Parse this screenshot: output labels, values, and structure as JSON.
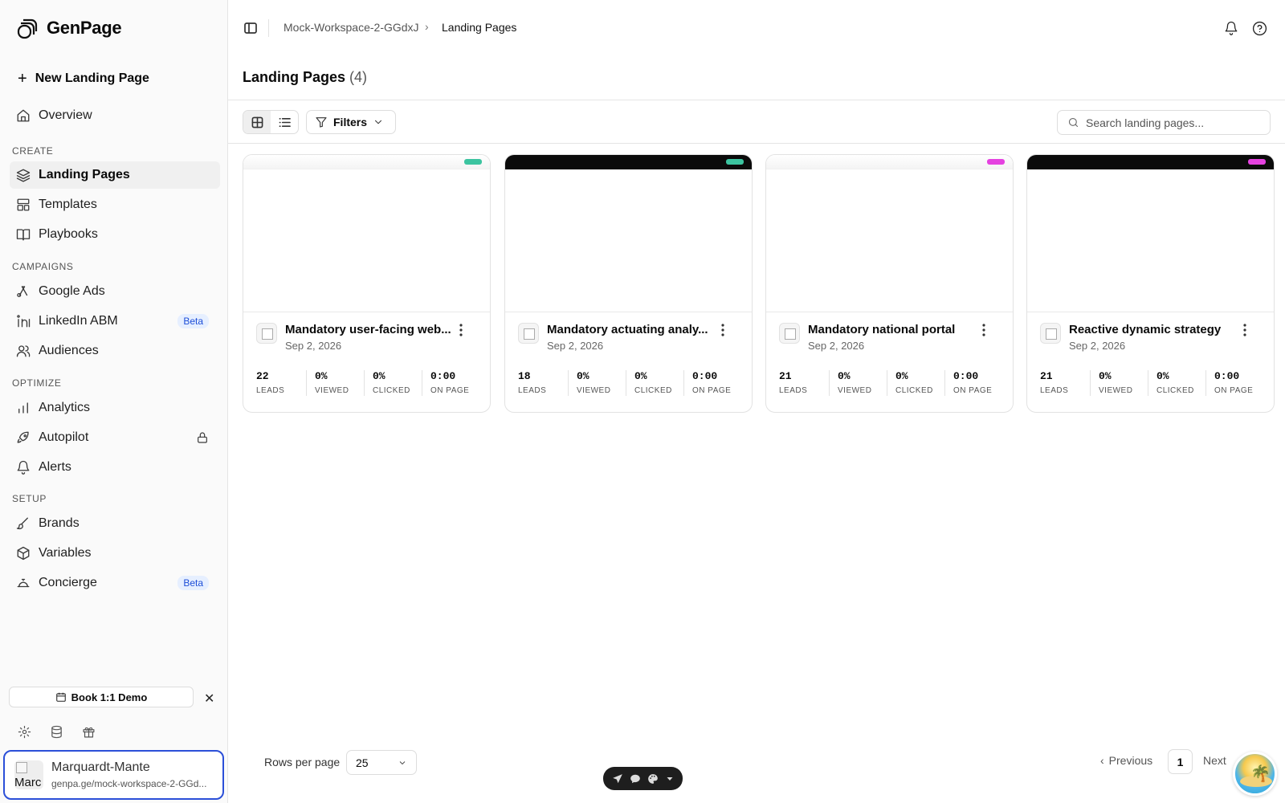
{
  "app": {
    "name": "GenPage"
  },
  "sidebar": {
    "new_page_label": "New Landing Page",
    "overview": {
      "label": "Overview",
      "icon": "home-icon"
    },
    "sections": {
      "create": "CREATE",
      "campaigns": "CAMPAIGNS",
      "optimize": "OPTIMIZE",
      "setup": "SETUP"
    },
    "items": {
      "landing_pages": {
        "label": "Landing Pages",
        "icon": "layers-icon"
      },
      "templates": {
        "label": "Templates",
        "icon": "layout-icon"
      },
      "playbooks": {
        "label": "Playbooks",
        "icon": "book-icon"
      },
      "google_ads": {
        "label": "Google Ads",
        "icon": "google-ads-icon"
      },
      "linkedin_abm": {
        "label": "LinkedIn ABM",
        "badge": "Beta",
        "icon": "linkedin-icon"
      },
      "audiences": {
        "label": "Audiences",
        "icon": "users-icon"
      },
      "analytics": {
        "label": "Analytics",
        "icon": "bar-chart-icon"
      },
      "autopilot": {
        "label": "Autopilot",
        "icon": "rocket-icon"
      },
      "alerts": {
        "label": "Alerts",
        "icon": "bell-icon"
      },
      "brands": {
        "label": "Brands",
        "icon": "brush-icon"
      },
      "variables": {
        "label": "Variables",
        "icon": "box-icon"
      },
      "concierge": {
        "label": "Concierge",
        "badge": "Beta",
        "icon": "concierge-bell-icon"
      }
    },
    "demo_button": "Book 1:1 Demo",
    "workspace": {
      "name": "Marquardt-Mante",
      "url": "genpa.ge/mock-workspace-2-GGd...",
      "avatar_text": "Marc"
    }
  },
  "header": {
    "breadcrumb": [
      "Mock-Workspace-2-GGdxJ",
      "Landing Pages"
    ],
    "title": "Landing Pages",
    "count": "(4)"
  },
  "toolbar": {
    "filters_label": "Filters",
    "search_placeholder": "Search landing pages..."
  },
  "colors": {
    "accent_teal": "#3cc4a0",
    "accent_magenta": "#e542e0",
    "focus_ring": "#2b4fd8"
  },
  "cards": [
    {
      "name": "Mandatory user-facing web...",
      "date": "Sep 2, 2026",
      "theme": "light",
      "chip_color": "#3cc4a0",
      "stats": [
        {
          "value": "22",
          "label": "LEADS"
        },
        {
          "value": "0%",
          "label": "VIEWED"
        },
        {
          "value": "0%",
          "label": "CLICKED"
        },
        {
          "value": "0:00",
          "label": "ON PAGE"
        }
      ]
    },
    {
      "name": "Mandatory actuating analy...",
      "date": "Sep 2, 2026",
      "theme": "dark",
      "chip_color": "#3cc4a0",
      "stats": [
        {
          "value": "18",
          "label": "LEADS"
        },
        {
          "value": "0%",
          "label": "VIEWED"
        },
        {
          "value": "0%",
          "label": "CLICKED"
        },
        {
          "value": "0:00",
          "label": "ON PAGE"
        }
      ]
    },
    {
      "name": "Mandatory national portal",
      "date": "Sep 2, 2026",
      "theme": "light",
      "chip_color": "#e542e0",
      "stats": [
        {
          "value": "21",
          "label": "LEADS"
        },
        {
          "value": "0%",
          "label": "VIEWED"
        },
        {
          "value": "0%",
          "label": "CLICKED"
        },
        {
          "value": "0:00",
          "label": "ON PAGE"
        }
      ]
    },
    {
      "name": "Reactive dynamic strategy",
      "date": "Sep 2, 2026",
      "theme": "dark",
      "chip_color": "#e542e0",
      "stats": [
        {
          "value": "21",
          "label": "LEADS"
        },
        {
          "value": "0%",
          "label": "VIEWED"
        },
        {
          "value": "0%",
          "label": "CLICKED"
        },
        {
          "value": "0:00",
          "label": "ON PAGE"
        }
      ]
    }
  ],
  "pagination": {
    "rows_label": "Rows per page",
    "rows_value": "25",
    "previous": "Previous",
    "page": "1",
    "next": "Next"
  }
}
